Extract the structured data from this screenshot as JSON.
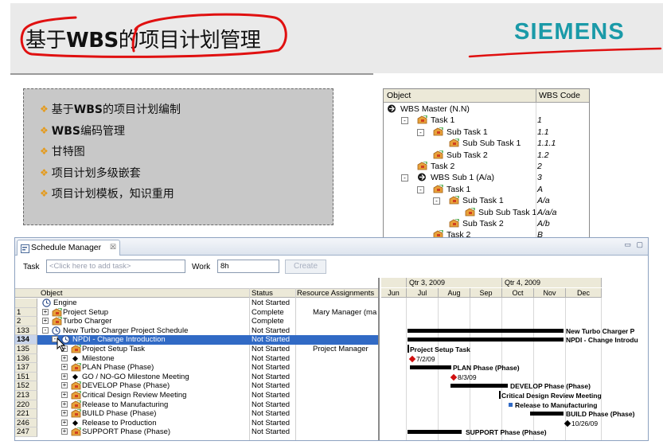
{
  "slide": {
    "title_pre": "基于",
    "title_bold": "WBS",
    "title_post": "的项目计划管理",
    "brand": "SIEMENS",
    "brand_color": "#1a9aa8",
    "annotation_color": "#e01010"
  },
  "bullets": [
    "基于WBS的项目计划编制",
    "WBS编码管理",
    "甘特图",
    "项目计划多级嵌套",
    "项目计划模板，知识重用"
  ],
  "wbs_tree": {
    "col_object": "Object",
    "col_code": "WBS Code",
    "rows": [
      {
        "label": "WBS Master (N.N)",
        "code": "",
        "icon": "wbs-icon"
      },
      {
        "label": "Task 1",
        "code": "1",
        "icon": "task-icon"
      },
      {
        "label": "Sub Task 1",
        "code": "1.1",
        "icon": "task-icon"
      },
      {
        "label": "Sub Sub Task 1",
        "code": "1.1.1",
        "icon": "task-icon"
      },
      {
        "label": "Sub Task 2",
        "code": "1.2",
        "icon": "task-icon"
      },
      {
        "label": "Task 2",
        "code": "2",
        "icon": "task-icon"
      },
      {
        "label": "WBS Sub 1 (A/a)",
        "code": "3",
        "icon": "wbs-icon"
      },
      {
        "label": "Task 1",
        "code": "A",
        "icon": "task-icon"
      },
      {
        "label": "Sub Task 1",
        "code": "A/a",
        "icon": "task-icon"
      },
      {
        "label": "Sub Sub Task 1",
        "code": "A/a/a",
        "icon": "task-icon"
      },
      {
        "label": "Sub Task 2",
        "code": "A/b",
        "icon": "task-icon"
      },
      {
        "label": "Task 2",
        "code": "B",
        "icon": "task-icon"
      }
    ]
  },
  "schedule": {
    "tab_title": "Schedule Manager",
    "tab_close": "☒",
    "win_buttons": "▭ ▢",
    "task_label": "Task",
    "task_placeholder": "<Click here to add task>",
    "work_label": "Work",
    "work_value": "8h",
    "create_label": "Create",
    "col_object": "Object",
    "col_status": "Status",
    "col_resource": "Resource Assignments",
    "rows": [
      {
        "num": "",
        "name": "Engine",
        "status": "Not Started",
        "resource": "",
        "icon": "clock-icon",
        "indent": 0,
        "exp": ""
      },
      {
        "num": "1",
        "name": "Project Setup",
        "status": "Complete",
        "resource": "Mary Manager (ma",
        "icon": "task-icon",
        "indent": 1,
        "exp": "+"
      },
      {
        "num": "2",
        "name": "Turbo Charger",
        "status": "Complete",
        "resource": "",
        "icon": "task-icon",
        "indent": 1,
        "exp": "+"
      },
      {
        "num": "133",
        "name": "New Turbo Charger Project Schedule",
        "status": "Not Started",
        "resource": "",
        "icon": "clock-icon",
        "indent": 1,
        "exp": "-"
      },
      {
        "num": "134",
        "name": "NPDI - Change Introduction",
        "status": "Not Started",
        "resource": "",
        "icon": "clock-icon",
        "indent": 2,
        "exp": "-",
        "selected": true
      },
      {
        "num": "135",
        "name": "Project Setup Task",
        "status": "Not Started",
        "resource": "Project Manager",
        "icon": "task-icon",
        "indent": 3,
        "exp": "+"
      },
      {
        "num": "136",
        "name": "Milestone",
        "status": "Not Started",
        "resource": "",
        "icon": "milestone-icon",
        "indent": 3,
        "exp": "+"
      },
      {
        "num": "137",
        "name": "PLAN Phase (Phase)",
        "status": "Not Started",
        "resource": "",
        "icon": "task-icon",
        "indent": 3,
        "exp": "+"
      },
      {
        "num": "151",
        "name": "GO / NO-GO Milestone Meeting",
        "status": "Not Started",
        "resource": "",
        "icon": "milestone-icon",
        "indent": 3,
        "exp": "+"
      },
      {
        "num": "152",
        "name": "DEVELOP Phase (Phase)",
        "status": "Not Started",
        "resource": "",
        "icon": "task-icon",
        "indent": 3,
        "exp": "+"
      },
      {
        "num": "213",
        "name": "Critical Design Review Meeting",
        "status": "Not Started",
        "resource": "",
        "icon": "task-icon",
        "indent": 3,
        "exp": "+"
      },
      {
        "num": "220",
        "name": "Release to Manufacturing",
        "status": "Not Started",
        "resource": "",
        "icon": "task-icon",
        "indent": 3,
        "exp": "+"
      },
      {
        "num": "221",
        "name": "BUILD Phase (Phase)",
        "status": "Not Started",
        "resource": "",
        "icon": "task-icon",
        "indent": 3,
        "exp": "+"
      },
      {
        "num": "246",
        "name": "Release to Production",
        "status": "Not Started",
        "resource": "",
        "icon": "milestone-icon",
        "indent": 3,
        "exp": "+"
      },
      {
        "num": "247",
        "name": "SUPPORT Phase (Phase)",
        "status": "Not Started",
        "resource": "",
        "icon": "task-icon",
        "indent": 3,
        "exp": "+"
      }
    ],
    "gantt": {
      "quarters": [
        "Qtr 3, 2009",
        "Qtr 4, 2009"
      ],
      "months": [
        "Jun",
        "Jul",
        "Aug",
        "Sep",
        "Oct",
        "Nov",
        "Dec"
      ],
      "labels": {
        "new_turbo": "New Turbo Charger P",
        "npdi": "NPDI - Change Introdu",
        "project_setup": "Project Setup Task",
        "milestone_date": "7/2/09",
        "plan": "PLAN Phase (Phase)",
        "go_date": "8/3/09",
        "develop": "DEVELOP Phase (Phase)",
        "cdr": "Critical Design Review Meeting",
        "rtm": "Release to Manufacturing",
        "build": "BUILD Phase (Phase)",
        "rtp_date": "10/26/09",
        "support": "SUPPORT Phase (Phase)"
      }
    }
  }
}
